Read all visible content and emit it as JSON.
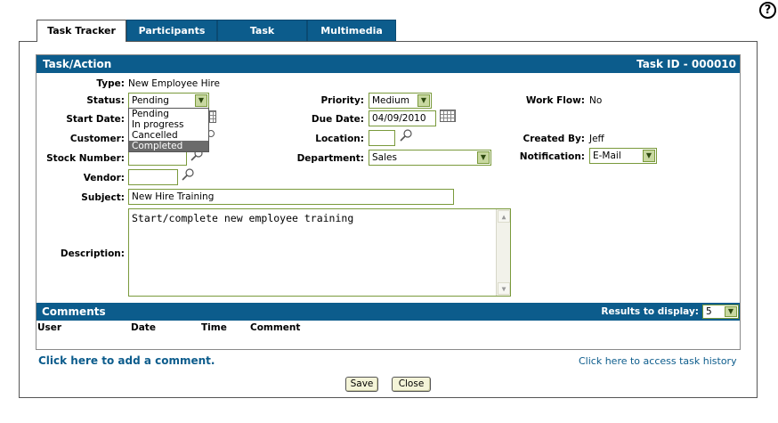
{
  "tabs": [
    {
      "label": "Task Tracker",
      "active": true
    },
    {
      "label": "Participants",
      "active": false
    },
    {
      "label": "Task",
      "active": false
    },
    {
      "label": "Multimedia",
      "active": false
    }
  ],
  "section": {
    "title": "Task/Action",
    "task_id": "Task ID - 000010"
  },
  "fields": {
    "type": {
      "label": "Type:",
      "value": "New Employee Hire"
    },
    "status": {
      "label": "Status:",
      "value": "Pending",
      "options": [
        "Pending",
        "In progress",
        "Cancelled",
        "Completed"
      ],
      "highlighted": "Completed"
    },
    "start_date": {
      "label": "Start Date:"
    },
    "customer": {
      "label": "Customer:"
    },
    "stock_number": {
      "label": "Stock Number:"
    },
    "vendor": {
      "label": "Vendor:"
    },
    "subject": {
      "label": "Subject:",
      "value": "New Hire Training"
    },
    "description": {
      "label": "Description:",
      "value": "Start/complete new employee training"
    },
    "priority": {
      "label": "Priority:",
      "value": "Medium"
    },
    "due_date": {
      "label": "Due Date:",
      "value": "04/09/2010"
    },
    "location": {
      "label": "Location:"
    },
    "department": {
      "label": "Department:",
      "value": "Sales"
    },
    "work_flow": {
      "label": "Work Flow:",
      "value": "No"
    },
    "created_by": {
      "label": "Created By:",
      "value": "Jeff"
    },
    "notification": {
      "label": "Notification:",
      "value": "E-Mail"
    }
  },
  "comments": {
    "title": "Comments",
    "results_label": "Results to display:",
    "results_value": "5",
    "columns": [
      "User",
      "Date",
      "Time",
      "Comment"
    ]
  },
  "links": {
    "add_comment": "Click here to add a comment.",
    "task_history": "Click here to access task history"
  },
  "buttons": {
    "save": "Save",
    "close": "Close"
  },
  "help": "?",
  "colors": {
    "accent": "#0c5c8c",
    "field_border": "#7a9a3c"
  }
}
